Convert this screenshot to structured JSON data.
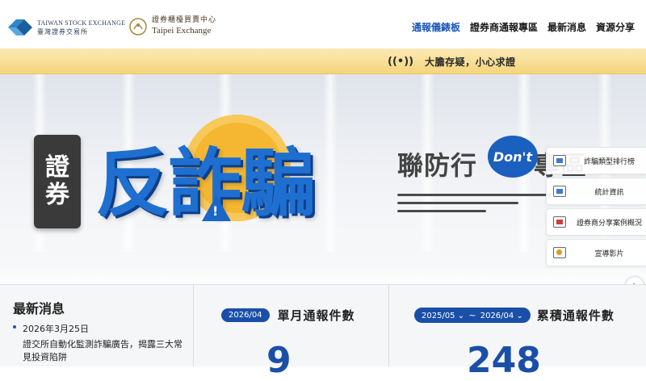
{
  "header": {
    "twse_logo": {
      "en": "TAIWAN STOCK EXCHANGE",
      "zh": "臺灣證券交易所"
    },
    "tpex_logo": {
      "zh": "證券櫃檯買賣中心",
      "en": "Taipei Exchange"
    },
    "nav": [
      {
        "label": "通報儀錶板",
        "active": true
      },
      {
        "label": "證券商通報專區",
        "active": false
      },
      {
        "label": "最新消息",
        "active": false
      },
      {
        "label": "資源分享",
        "active": false
      }
    ],
    "colors": {
      "nav_active": "#1a55b8"
    }
  },
  "slogan": {
    "icon": "broadcast-icon",
    "text": "大膽存疑，小心求證"
  },
  "hero": {
    "badge": [
      "證",
      "券"
    ],
    "title_chars": [
      "反",
      "詐",
      "騙"
    ],
    "subtitle": "聯防行",
    "dont_label": "Don't",
    "subtitle_end": "專區",
    "colors": {
      "title": "#1f6fd1",
      "circle": "#f5b731"
    }
  },
  "side_menu": [
    {
      "icon": "ranking-icon",
      "label": "詐騙類型排行榜"
    },
    {
      "icon": "statistics-icon",
      "label": "統計資訊"
    },
    {
      "icon": "share-cases-icon",
      "label": "證券商分享案例概況"
    },
    {
      "icon": "video-icon",
      "label": "宣導影片"
    }
  ],
  "news": {
    "title": "最新消息",
    "items": [
      {
        "date": "2026年3月25日",
        "text": "證交所自動化監測詐騙廣告，揭露三大常見投資陷阱"
      }
    ]
  },
  "monthly": {
    "period": "2026/04",
    "label": "單月通報件數",
    "value": "9"
  },
  "cumulative": {
    "start": "2025/05",
    "end": "2026/04",
    "separator": "~",
    "label": "累積通報件數",
    "value": "248"
  }
}
